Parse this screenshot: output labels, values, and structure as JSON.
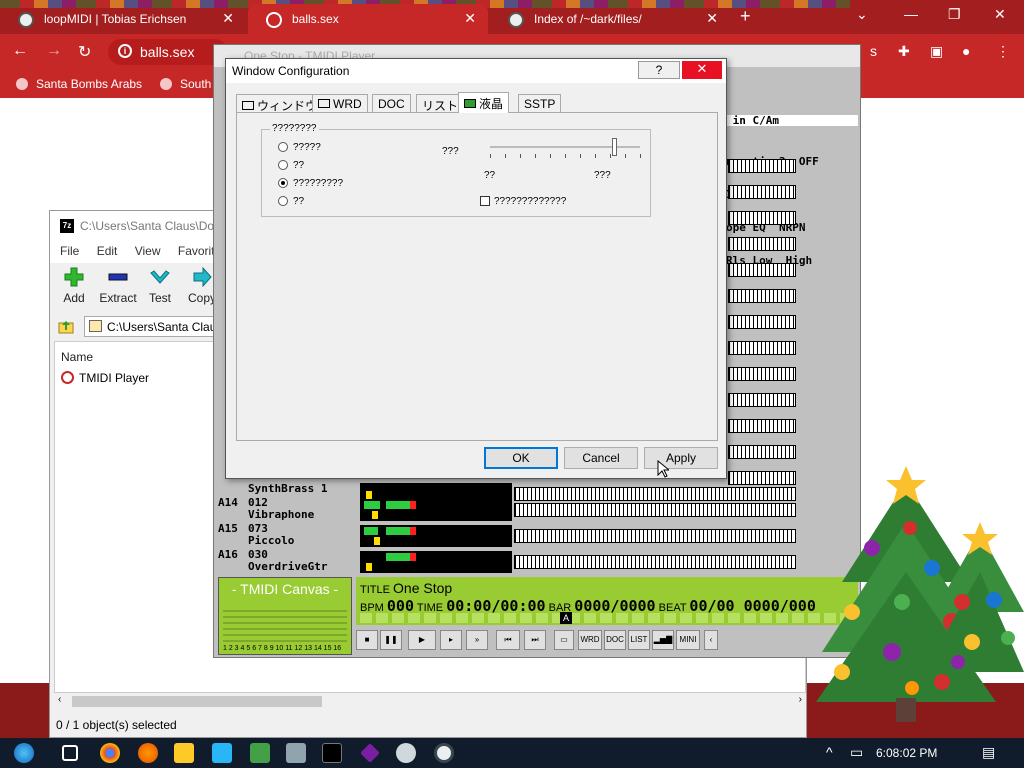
{
  "browser": {
    "tabs": [
      {
        "title": "loopMIDI | Tobias Erichsen",
        "active": false
      },
      {
        "title": "balls.sex",
        "active": true
      },
      {
        "title": "Index of /~dark/files/",
        "active": false
      }
    ],
    "new_tab_label": "+",
    "address": "balls.sex",
    "bookmarks": [
      "Santa Bombs Arabs",
      "South"
    ]
  },
  "zip": {
    "title": "C:\\Users\\Santa Claus\\Do",
    "menu": [
      "File",
      "Edit",
      "View",
      "Favorites"
    ],
    "toolbar": [
      "Add",
      "Extract",
      "Test",
      "Copy"
    ],
    "path": "C:\\Users\\Santa Clau",
    "column_name": "Name",
    "items": [
      "TMIDI Player"
    ],
    "status": "0 / 1 object(s) selected"
  },
  "tmidi": {
    "title": "One Stop - TMIDI Player",
    "right_text": [
      " in C/Am",
      "nsertion2  OFF",
      "ISTORTION",
      "ope EQ  NRPN",
      "Rls Low  High"
    ],
    "channels": [
      {
        "id": "",
        "num": "",
        "name": "SynthBrass 1"
      },
      {
        "id": "A14",
        "num": "012",
        "name": "Vibraphone"
      },
      {
        "id": "A15",
        "num": "073",
        "name": "Piccolo"
      },
      {
        "id": "A16",
        "num": "030",
        "name": "OverdriveGtr"
      }
    ],
    "canvas_title": "- TMIDI Canvas -",
    "canvas_ticks": "1 2 3 4 5 6 7 8 9 10 11 12 13 14 15 16",
    "lcd": {
      "title_label": "TITLE",
      "title": "One Stop",
      "bpm_label": "BPM",
      "bpm": "000",
      "time_label": "TIME",
      "time": "00:00/00:00",
      "bar_label": "BAR",
      "bar": "0000/0000",
      "beat_label": "BEAT",
      "beat": "00/00 0000/000"
    },
    "controls": [
      "WRD",
      "DOC",
      "LIST",
      "MINI"
    ]
  },
  "dialog": {
    "title": "Window Configuration",
    "help": "?",
    "close": "✕",
    "tabs": [
      "ウィンドウ",
      "WRD",
      "DOC",
      "リスト",
      "液晶",
      "SSTP"
    ],
    "active_tab": 4,
    "group_label": "????????",
    "radios": [
      "?????",
      "??",
      "?????????",
      "??"
    ],
    "selected_radio": 2,
    "text_a": "???",
    "text_b": "??",
    "text_c": "???",
    "checkbox": "?????????????",
    "buttons": {
      "ok": "OK",
      "cancel": "Cancel",
      "apply": "Apply"
    }
  },
  "taskbar": {
    "clock": "6:08:02 PM"
  },
  "colors": {
    "browser_red": "#c62828",
    "lcd_green": "#99cc33",
    "taskbar": "#101c2c"
  }
}
